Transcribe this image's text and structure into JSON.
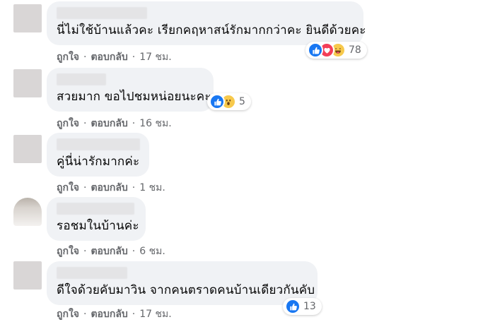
{
  "comments": [
    {
      "text": "นี่ไม่ใช้บ้านแล้วคะ เรียกคฤหาสน์รักมากกว่าคะ ยินดีด้วยคะ",
      "like_label": "ถูกใจ",
      "reply_label": "ตอบกลับ",
      "separator": "·",
      "time": "17 ชม.",
      "reactions": [
        "like-icon",
        "love-icon",
        "haha-icon"
      ],
      "reaction_count": "78"
    },
    {
      "text": "สวยมาก ขอไปชมหน่อยนะคะ",
      "like_label": "ถูกใจ",
      "reply_label": "ตอบกลับ",
      "separator": "·",
      "time": "16 ชม.",
      "reactions": [
        "like-icon",
        "wow-icon"
      ],
      "reaction_count": "5"
    },
    {
      "text": "คู่นี่น่ารักมากค่ะ",
      "like_label": "ถูกใจ",
      "reply_label": "ตอบกลับ",
      "separator": "·",
      "time": "1 ชม."
    },
    {
      "text": "รอชมในบ้านค่ะ",
      "like_label": "ถูกใจ",
      "reply_label": "ตอบกลับ",
      "separator": "·",
      "time": "6 ชม."
    },
    {
      "text": "ดีใจด้วยคับมาวิน จากคนตราดคนบ้านเดียวกันคับ",
      "like_label": "ถูกใจ",
      "reply_label": "ตอบกลับ",
      "separator": "·",
      "time": "17 ชม.",
      "reactions": [
        "like-icon"
      ],
      "reaction_count": "13"
    }
  ],
  "colors": {
    "bubble": "#f0f2f5",
    "meta_text": "#65676b",
    "like_blue": "#1877f2",
    "love_red": "#f33e58",
    "haha_yellow": "#f7c94c"
  }
}
